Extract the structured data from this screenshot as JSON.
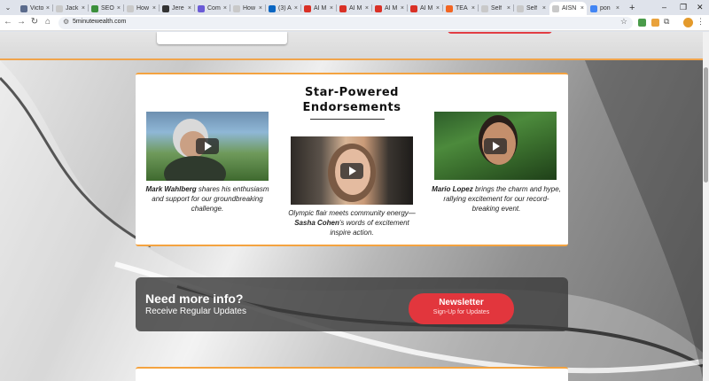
{
  "browser": {
    "tabs": [
      {
        "title": "Victo",
        "color": "#5b6b8c"
      },
      {
        "title": "Jack",
        "color": "#c9c9c9"
      },
      {
        "title": "SEO",
        "color": "#3b8f3b"
      },
      {
        "title": "How",
        "color": "#c9c9c9"
      },
      {
        "title": "Jere",
        "color": "#333333"
      },
      {
        "title": "Com",
        "color": "#6b5bd6"
      },
      {
        "title": "How",
        "color": "#c9c9c9"
      },
      {
        "title": "(3) A",
        "color": "#0a66c2"
      },
      {
        "title": "AI M",
        "color": "#d93025"
      },
      {
        "title": "AI M",
        "color": "#d93025"
      },
      {
        "title": "AI M",
        "color": "#d93025"
      },
      {
        "title": "AI M",
        "color": "#d93025"
      },
      {
        "title": "TEA",
        "color": "#f26522"
      },
      {
        "title": "Self",
        "color": "#c9c9c9"
      },
      {
        "title": "Self",
        "color": "#c9c9c9"
      },
      {
        "title": "AISN",
        "color": "#c9c9c9",
        "active": true
      },
      {
        "title": "pon",
        "color": "#4285f4"
      }
    ],
    "new_tab": "+",
    "url": "5minutewealth.com",
    "profile_initial": ""
  },
  "section": {
    "title_line1": "Star-Powered",
    "title_line2": "Endorsements"
  },
  "endorsements": [
    {
      "name": "Mark Wahlberg",
      "text": " shares his enthusiasm and support for our groundbreaking challenge."
    },
    {
      "prefix": "Olympic flair meets community energy—",
      "name": "Sasha Cohen",
      "text": "'s words of excitement inspire action."
    },
    {
      "name": "Mario Lopez",
      "text": " brings the charm and hype, rallying excitement for our record-breaking event."
    }
  ],
  "info": {
    "title": "Need more info?",
    "subtitle": "Receive Regular Updates",
    "button_label": "Newsletter",
    "button_sub": "Sign-Up for Updates"
  },
  "colors": {
    "accent_orange": "#f4a340",
    "button_red": "#e2363d"
  }
}
